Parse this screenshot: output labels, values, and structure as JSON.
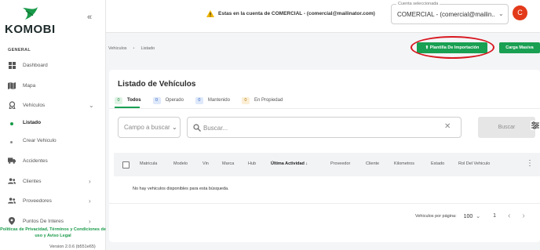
{
  "brand": {
    "name": "KOMOBI"
  },
  "sidebar": {
    "section_label": "GENERAL",
    "items": [
      {
        "label": "Dashboard",
        "icon": "dashboard-icon"
      },
      {
        "label": "Mapa",
        "icon": "map-icon"
      },
      {
        "label": "Vehículos",
        "icon": "vehicle-icon",
        "expanded": true
      },
      {
        "label": "Accidentes",
        "icon": "truck-icon"
      },
      {
        "label": "Clientes",
        "icon": "users-icon"
      },
      {
        "label": "Proveedores",
        "icon": "users-icon"
      },
      {
        "label": "Puntos De Interes",
        "icon": "pin-icon"
      }
    ],
    "sub_items": [
      {
        "label": "Listado",
        "active": true
      },
      {
        "label": "Crear Vehiculo",
        "active": false
      }
    ],
    "footer_links": "Políticas de Privacidad, Términos y Condiciones de uso y Aviso Legal",
    "version": "Version 2.0.6 (b551e65)"
  },
  "header": {
    "warning": "Estas en la cuenta de COMERCIAL - (comercial@mailinator.com)",
    "account_legend": "Cuenta seleccionada",
    "account_value": "COMERCIAL - (comercial@mailin...",
    "avatar_initial": "C"
  },
  "breadcrumb": {
    "items": [
      "Vehiculos",
      "Listado"
    ]
  },
  "actions": {
    "template_label": "⬆ Plantilla De Importación",
    "bulk_label": "Carga Masiva"
  },
  "list": {
    "title": "Listado de Vehículos",
    "tabs": [
      {
        "count": "0",
        "label": "Todos",
        "badge_bg": "#dff3e4",
        "badge_fg": "#1a8a46",
        "active": true
      },
      {
        "count": "0",
        "label": "Operado",
        "badge_bg": "#dde8fa",
        "badge_fg": "#3a66c4"
      },
      {
        "count": "0",
        "label": "Mantenido",
        "badge_bg": "#dde8fa",
        "badge_fg": "#3a66c4"
      },
      {
        "count": "0",
        "label": "En Propiedad",
        "badge_bg": "#fcefd6",
        "badge_fg": "#b07a12"
      }
    ],
    "filter_placeholder": "Campo a buscar",
    "search_placeholder": "Buscar...",
    "search_button": "Buscar",
    "columns": [
      "Matricula",
      "Modelo",
      "Vin",
      "Marca",
      "Hub",
      "Última Actividad",
      "Proveedor",
      "Cliente",
      "Kilometros",
      "Estado",
      "Rol Del Vehiculo"
    ],
    "empty_message": "No hay vehiculos disponibles para esta búsqueda.",
    "pagination": {
      "rows_per_page_label": "Vehiculos por página:",
      "rows_per_page": "100",
      "page": "1"
    }
  },
  "colors": {
    "accent": "#1aa053",
    "annotation": "#d8171f",
    "avatar": "#e23a1a"
  }
}
